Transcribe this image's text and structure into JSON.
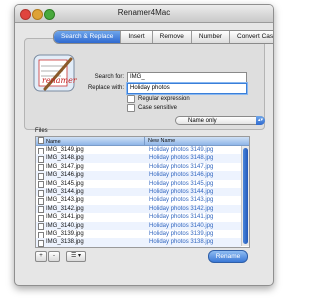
{
  "window": {
    "title": "Renamer4Mac"
  },
  "tabs": [
    {
      "label": "Search & Replace",
      "active": true
    },
    {
      "label": "Insert",
      "active": false
    },
    {
      "label": "Remove",
      "active": false
    },
    {
      "label": "Number",
      "active": false
    },
    {
      "label": "Convert Case",
      "active": false
    }
  ],
  "search_replace": {
    "logo_text": "renamer",
    "search_label": "Search for:",
    "search_value": "IMG_",
    "replace_label": "Replace with:",
    "replace_value": "Holiday photos ",
    "regex_label": "Regular expression",
    "regex_checked": false,
    "case_label": "Case sensitive",
    "case_checked": false,
    "scope_value": "Name only"
  },
  "files": {
    "section_label": "Files",
    "col_name": "Name",
    "col_new_name": "New Name",
    "rows": [
      {
        "name": "IMG_3149.jpg",
        "new_name": "Holiday photos 3149.jpg"
      },
      {
        "name": "IMG_3148.jpg",
        "new_name": "Holiday photos 3148.jpg"
      },
      {
        "name": "IMG_3147.jpg",
        "new_name": "Holiday photos 3147.jpg"
      },
      {
        "name": "IMG_3146.jpg",
        "new_name": "Holiday photos 3146.jpg"
      },
      {
        "name": "IMG_3145.jpg",
        "new_name": "Holiday photos 3145.jpg"
      },
      {
        "name": "IMG_3144.jpg",
        "new_name": "Holiday photos 3144.jpg"
      },
      {
        "name": "IMG_3143.jpg",
        "new_name": "Holiday photos 3143.jpg"
      },
      {
        "name": "IMG_3142.jpg",
        "new_name": "Holiday photos 3142.jpg"
      },
      {
        "name": "IMG_3141.jpg",
        "new_name": "Holiday photos 3141.jpg"
      },
      {
        "name": "IMG_3140.jpg",
        "new_name": "Holiday photos 3140.jpg"
      },
      {
        "name": "IMG_3139.jpg",
        "new_name": "Holiday photos 3139.jpg"
      },
      {
        "name": "IMG_3138.jpg",
        "new_name": "Holiday photos 3138.jpg"
      },
      {
        "name": "IMG_3137.jpg",
        "new_name": "Holiday photos 3137.jpg"
      }
    ]
  },
  "footer": {
    "add_label": "+",
    "remove_label": "-",
    "action_label": "☰ ▾",
    "rename_label": "Rename"
  },
  "colors": {
    "accent": "#2f6ad0",
    "new_name_text": "#3468c0"
  }
}
